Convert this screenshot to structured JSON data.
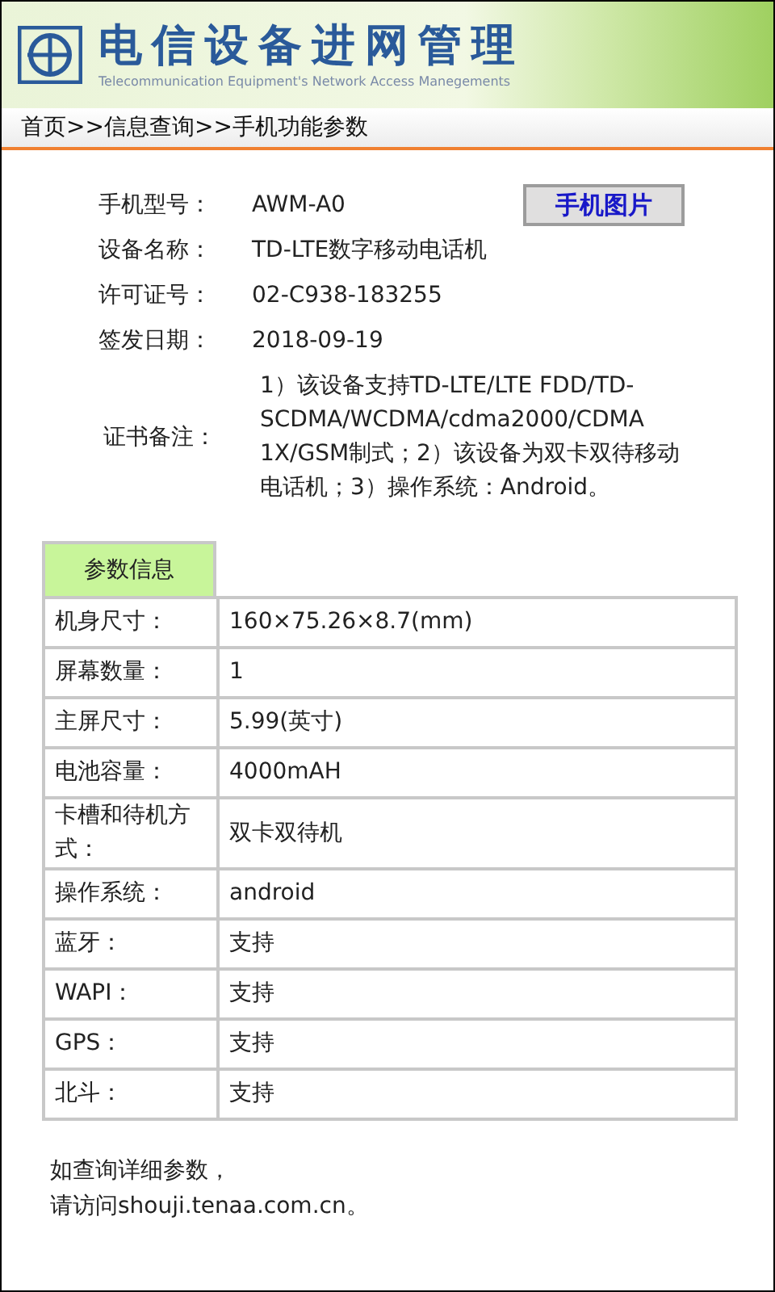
{
  "banner": {
    "title": "电信设备进网管理",
    "subtitle": "Telecommunication Equipment's Network Access Manegements"
  },
  "breadcrumb": "首页>>信息查询>>手机功能参数",
  "info": [
    {
      "label": "手机型号：",
      "value": "AWM-A0"
    },
    {
      "label": "设备名称：",
      "value": "TD-LTE数字移动电话机"
    },
    {
      "label": "许可证号：",
      "value": "02-C938-183255"
    },
    {
      "label": "签发日期：",
      "value": "2018-09-19"
    },
    {
      "label": "证书备注：",
      "value": "1）该设备支持TD-LTE/LTE FDD/TD-SCDMA/WCDMA/cdma2000/CDMA 1X/GSM制式；2）该设备为双卡双待移动电话机；3）操作系统：Android。"
    }
  ],
  "photo_button": "手机图片",
  "params": {
    "tab": "参数信息",
    "rows": [
      {
        "label": "机身尺寸：",
        "value": "160×75.26×8.7(mm)"
      },
      {
        "label": "屏幕数量：",
        "value": "1"
      },
      {
        "label": "主屏尺寸：",
        "value": "5.99(英寸)"
      },
      {
        "label": "电池容量：",
        "value": "4000mAH"
      },
      {
        "label": "卡槽和待机方式：",
        "value": "双卡双待机"
      },
      {
        "label": "操作系统：",
        "value": "android"
      },
      {
        "label": "蓝牙：",
        "value": "支持"
      },
      {
        "label": "WAPI：",
        "value": "支持"
      },
      {
        "label": "GPS：",
        "value": "支持"
      },
      {
        "label": "北斗：",
        "value": "支持"
      }
    ]
  },
  "footer": [
    "如查询详细参数，",
    "请访问shouji.tenaa.com.cn。"
  ]
}
